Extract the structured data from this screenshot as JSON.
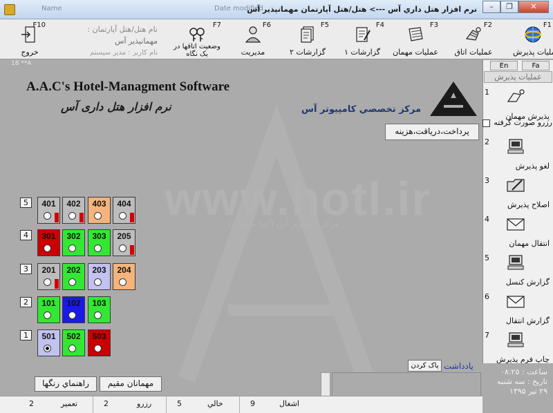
{
  "window": {
    "title": "نرم افزار هتل داري آس     --->  هتل/هتل آپارتمان مهمانپذير آس",
    "ghost_left": "Name",
    "ghost_mid": "Date modified",
    "controls": {
      "minimize": "–",
      "restore": "❐",
      "close": "✕"
    }
  },
  "toolbar": {
    "items": [
      {
        "key": "F1",
        "label": "عمليات پذيرش"
      },
      {
        "key": "F2",
        "label": "عمليات اتاق"
      },
      {
        "key": "F3",
        "label": "عمليات مهمان"
      },
      {
        "key": "F4",
        "label": "گزارشات ۱"
      },
      {
        "key": "F5",
        "label": "گزارشات ۲"
      },
      {
        "key": "F6",
        "label": "مديريت"
      },
      {
        "key": "F7",
        "label": "وضعيت اتاقها در يک نگاه"
      },
      {
        "key": "F10",
        "label": "خروج"
      }
    ],
    "info": {
      "hotel_label": "نام هتل/هتل آپارتمان :",
      "hotel_name": "مهمانپذير آس",
      "user_label": "نام کاربر : مدير سيستم"
    }
  },
  "version": "18 **A",
  "header": {
    "title_en": "A.A.C's Hotel-Managment Software",
    "title_fa": "نرم افزار هتل داری آس",
    "company": "مرکز تخصصي کامپيوتر آس",
    "watermark": "www.hotl.ir",
    "watermark_sub": "مرکز کامپيوتر آس (آسا سيستم)"
  },
  "pay_button": "پرداخت،درياقت،هزينه",
  "colors": {
    "empty": "#33e833",
    "occupied": "#cc0000",
    "reserved": "#c2c2f0",
    "repair": "#f6b47c",
    "inactive": "#bdbdbd",
    "special": "#1a1ae6"
  },
  "floors": [
    {
      "label": "5",
      "rooms": [
        {
          "num": "401",
          "color": "gray",
          "flag": true
        },
        {
          "num": "402",
          "color": "gray",
          "flag": true
        },
        {
          "num": "403",
          "color": "orange",
          "flag": false
        },
        {
          "num": "404",
          "color": "gray",
          "flag": true
        }
      ]
    },
    {
      "label": "4",
      "rooms": [
        {
          "num": "301",
          "color": "red",
          "flag": false
        },
        {
          "num": "302",
          "color": "green",
          "flag": false
        },
        {
          "num": "303",
          "color": "green",
          "flag": false
        },
        {
          "num": "205",
          "color": "gray",
          "flag": true
        }
      ]
    },
    {
      "label": "3",
      "rooms": [
        {
          "num": "201",
          "color": "gray",
          "flag": true
        },
        {
          "num": "202",
          "color": "green",
          "flag": false
        },
        {
          "num": "203",
          "color": "lav",
          "flag": false
        },
        {
          "num": "204",
          "color": "orange",
          "flag": false
        }
      ]
    },
    {
      "label": "2",
      "rooms": [
        {
          "num": "101",
          "color": "green",
          "flag": false
        },
        {
          "num": "102",
          "color": "blue",
          "flag": false
        },
        {
          "num": "103",
          "color": "green",
          "flag": false
        }
      ]
    },
    {
      "label": "1",
      "rooms": [
        {
          "num": "501",
          "color": "lav",
          "flag": false,
          "selected": true
        },
        {
          "num": "502",
          "color": "green",
          "flag": false
        },
        {
          "num": "503",
          "color": "red",
          "flag": false
        }
      ]
    }
  ],
  "notes": {
    "label": "يادداشت",
    "clear": "پاک کردن"
  },
  "bottom_buttons": {
    "guide": "راهنماي رنگها",
    "guests": "مهمانان مقيم"
  },
  "right_panel": {
    "lang_en": "En",
    "lang_fa": "Fa",
    "title": "عمليات پذيرش",
    "checkbox": "رزرو صورت گرفته",
    "items": [
      {
        "n": "1",
        "label": "پذيرش مهمان"
      },
      {
        "n": "2",
        "label": "لغو پذيرش"
      },
      {
        "n": "3",
        "label": "اصلاح پذيرش"
      },
      {
        "n": "4",
        "label": "انتقال مهمان"
      },
      {
        "n": "5",
        "label": "گزارش کنسل"
      },
      {
        "n": "6",
        "label": "گزارش انتقال"
      },
      {
        "n": "7",
        "label": "چاپ فرم پذيرش"
      }
    ]
  },
  "clock": {
    "time": "ساعت : ۰۸:۲۵",
    "date_label": "تاريخ : سه شنبه",
    "date": "۲۹ تير ۱۳۹۵"
  },
  "status": [
    {
      "label": "اشغال",
      "value": "9"
    },
    {
      "label": "خالي",
      "value": "5"
    },
    {
      "label": "رزرو",
      "value": "2"
    },
    {
      "label": "تعمير",
      "value": "2"
    }
  ]
}
